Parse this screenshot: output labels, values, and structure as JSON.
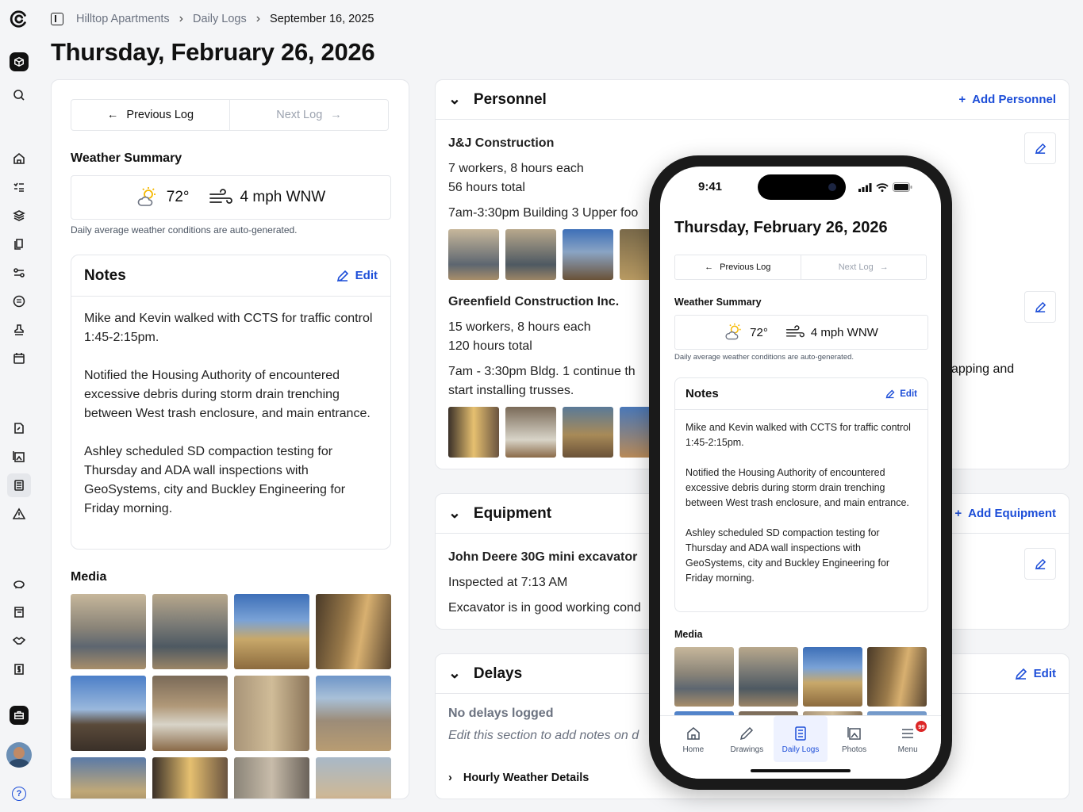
{
  "breadcrumb": {
    "items": [
      "Hilltop Apartments",
      "Daily Logs"
    ],
    "current": "September 16, 2025"
  },
  "page_title": "Thursday, February 26, 2026",
  "nav": {
    "previous": "Previous Log",
    "next": "Next Log"
  },
  "weather": {
    "heading": "Weather Summary",
    "temperature": "72°",
    "wind": "4 mph WNW",
    "note": "Daily average weather conditions are auto-generated."
  },
  "notes": {
    "heading": "Notes",
    "edit_label": "Edit",
    "paragraphs": [
      "Mike and Kevin walked with CCTS for traffic control 1:45-2:15pm.",
      "Notified the Housing Authority of encountered excessive debris during storm drain trenching between West trash enclosure, and main entrance.",
      "Ashley scheduled SD compaction testing for Thursday and ADA wall inspections with GeoSystems, city and Buckley Engineering for Friday morning."
    ]
  },
  "media": {
    "heading": "Media"
  },
  "personnel": {
    "heading": "Personnel",
    "add_label": "Add Personnel",
    "entries": [
      {
        "name": "J&J Construction",
        "line1": "7 workers, 8 hours each",
        "line2": "56 hours total",
        "desc": "7am-3:30pm Building 3 Upper foo"
      },
      {
        "name": "Greenfield Construction Inc.",
        "line1": "15 workers, 8 hours each",
        "line2": "120 hours total",
        "desc": "7am - 3:30pm Bldg. 1 continue th",
        "desc_right": "apping and",
        "desc2": "start installing trusses."
      }
    ]
  },
  "equipment": {
    "heading": "Equipment",
    "add_label": "Add Equipment",
    "name": "John Deere 30G mini excavator",
    "line1": "Inspected at 7:13 AM",
    "line2": "Excavator is in good working cond"
  },
  "delays": {
    "heading": "Delays",
    "edit_label": "Edit",
    "empty": "No delays logged",
    "hint": "Edit this section to add notes on d",
    "hourly": "Hourly Weather Details"
  },
  "phone": {
    "time": "9:41",
    "tabs": [
      "Home",
      "Drawings",
      "Daily Logs",
      "Photos",
      "Menu"
    ],
    "badge": "99"
  },
  "colors": {
    "accent": "#1d4ed8",
    "badge": "#dc2626"
  }
}
